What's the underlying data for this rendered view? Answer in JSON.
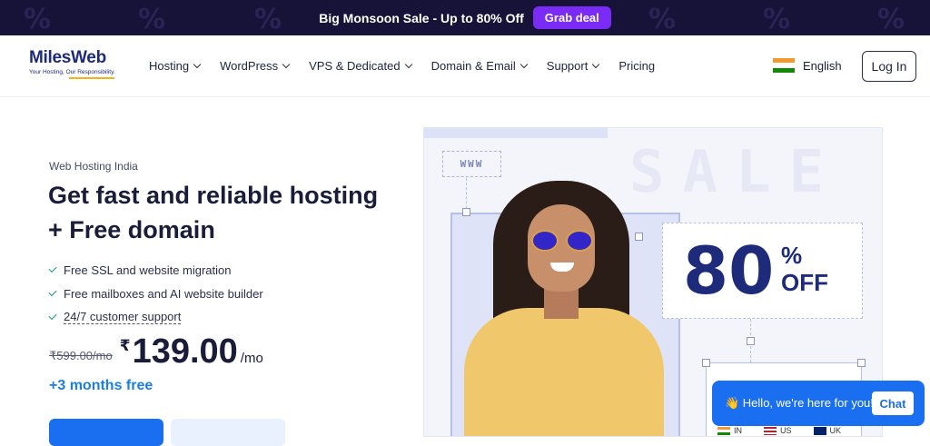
{
  "promo": {
    "text": "Big Monsoon Sale - Up to 80% Off",
    "button": "Grab deal",
    "deco_icon": "%"
  },
  "nav": {
    "logo_name": "MilesWeb",
    "logo_tagline": "Your Hosting, Our Responsibility.",
    "menu": [
      {
        "label": "Hosting"
      },
      {
        "label": "WordPress"
      },
      {
        "label": "VPS & Dedicated"
      },
      {
        "label": "Domain & Email"
      },
      {
        "label": "Support"
      },
      {
        "label": "Pricing"
      }
    ],
    "language": "English",
    "login": "Log In"
  },
  "hero": {
    "kicker": "Web Hosting India",
    "title": "Get fast and reliable hosting + Free domain",
    "features": [
      "Free SSL and website migration",
      "Free mailboxes and AI website builder",
      "24/7 customer support"
    ],
    "old_price": "₹599.00/mo",
    "currency": "₹",
    "price": "139.00",
    "per": "/mo",
    "bonus": "+3 months free"
  },
  "art": {
    "www_label": "WWW",
    "sale_label": "SALE",
    "discount_number": "80",
    "discount_percent": "%",
    "discount_off": "OFF",
    "country_flags": [
      {
        "code": "IN"
      },
      {
        "code": "US"
      },
      {
        "code": "UK"
      }
    ]
  },
  "chat": {
    "message": "👋 Hello, we're here for you!",
    "button": "Chat"
  },
  "colors": {
    "promo_bg": "#171338",
    "promo_button": "#7a2bf5",
    "brand_navy": "#1d2b7a",
    "accent_blue": "#1a6ff0",
    "check_green": "#19a36a"
  }
}
